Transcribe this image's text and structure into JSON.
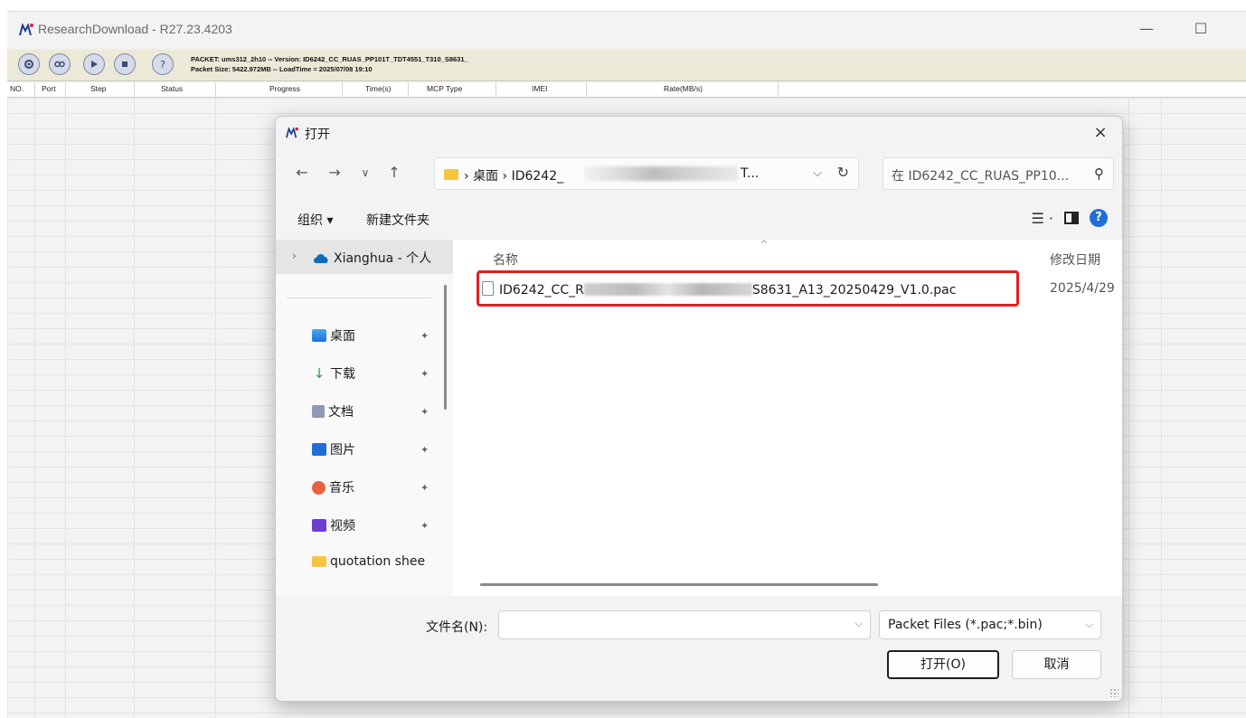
{
  "app": {
    "title": "ResearchDownload - R27.23.4203",
    "window_controls": {
      "minimize": "—",
      "maximize": "☐"
    },
    "packet_line1": "PACKET: ums312_2h10  --  Version: ID6242_CC_RUAS_PP101T_TDT4551_T310_S8631_",
    "packet_line2": "Packet Size: 5422.972MB  --  LoadTime = 2025/07/08 19:10",
    "columns": [
      "NO.",
      "Port",
      "Step",
      "Status",
      "Progress",
      "Time(s)",
      "MCP Type",
      "IMEI",
      "Rate(MB/s)"
    ]
  },
  "dialog": {
    "title": "打开",
    "close": "×",
    "nav": {
      "back": "←",
      "forward": "→",
      "recent": "∨",
      "up": "↑"
    },
    "breadcrumb_1": "桌面",
    "breadcrumb_2": "ID6242_",
    "breadcrumb_tail": "T...",
    "sep": "›",
    "search_placeholder": "在 ID6242_CC_RUAS_PP10...",
    "organize": "组织 ▾",
    "new_folder": "新建文件夹",
    "nav_pane": [
      {
        "label": "Xianghua - 个人",
        "icon": "cloud-icon",
        "color": "#0f6cbd"
      },
      {
        "label": "桌面",
        "icon": "desktop-icon",
        "color": "#2b88d8",
        "pinned": true
      },
      {
        "label": "下载",
        "icon": "download-icon",
        "color": "#2b9e4a",
        "pinned": true
      },
      {
        "label": "文档",
        "icon": "document-icon",
        "color": "#7a8aa6",
        "pinned": true
      },
      {
        "label": "图片",
        "icon": "picture-icon",
        "color": "#1f6fd6",
        "pinned": true
      },
      {
        "label": "音乐",
        "icon": "music-icon",
        "color": "#e8613c",
        "pinned": true
      },
      {
        "label": "视频",
        "icon": "video-icon",
        "color": "#6b3fd6",
        "pinned": true
      },
      {
        "label": "quotation shee",
        "icon": "folder-icon",
        "color": "#f5c542"
      }
    ],
    "pin_glyph": "✦",
    "column_name": "名称",
    "column_date": "修改日期",
    "files": [
      {
        "name_start": "ID6242_CC_R",
        "name_end": "S8631_A13_20250429_V1.0.pac",
        "date": "2025/4/29"
      }
    ],
    "filename_label": "文件名(N):",
    "filename_value": "",
    "filetype": "Packet Files (*.pac;*.bin)",
    "open_button": "打开(O)",
    "cancel_button": "取消"
  }
}
